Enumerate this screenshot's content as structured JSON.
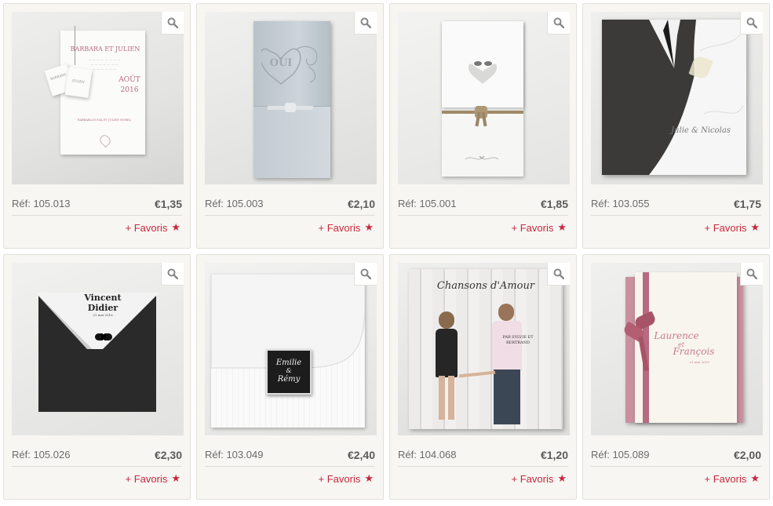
{
  "favorite_label": "+ Favoris",
  "products": [
    {
      "ref": "Réf: 105.013",
      "price": "€1,35",
      "art": {
        "names": "BARBARA ET JULIEN",
        "month": "AOÛT",
        "year": "2016",
        "couple": "BARBARA DUVAL ET JULIEN MOREL",
        "tag1": "BARBARA",
        "tag2": "JULIEN"
      }
    },
    {
      "ref": "Réf: 105.003",
      "price": "€2,10",
      "art": {
        "word": "OUI"
      }
    },
    {
      "ref": "Réf: 105.001",
      "price": "€1,85",
      "art": {}
    },
    {
      "ref": "Réf: 103.055",
      "price": "€1,75",
      "art": {
        "names": "Julie & Nicolas"
      }
    },
    {
      "ref": "Réf: 105.026",
      "price": "€2,30",
      "art": {
        "name1": "Vincent",
        "name2": "Didier",
        "date": "21 mai 2016"
      }
    },
    {
      "ref": "Réf: 103.049",
      "price": "€2,40",
      "art": {
        "name1": "Emilie",
        "amp": "&",
        "name2": "Rémy"
      }
    },
    {
      "ref": "Réf: 104.068",
      "price": "€1,20",
      "art": {
        "title": "Chansons d'Amour",
        "by": "PAR SYLVIE ET BERTRAND"
      }
    },
    {
      "ref": "Réf: 105.089",
      "price": "€2,00",
      "art": {
        "name1": "Laurence",
        "amp": "et",
        "name2": "François",
        "date": "21 mai 2016"
      }
    }
  ],
  "colors": {
    "accent": "#c8283c",
    "card_bg": "#f7f6f3",
    "border": "#e2e0da"
  },
  "icons": {
    "zoom": "magnifier-icon",
    "favorite": "star-icon"
  }
}
